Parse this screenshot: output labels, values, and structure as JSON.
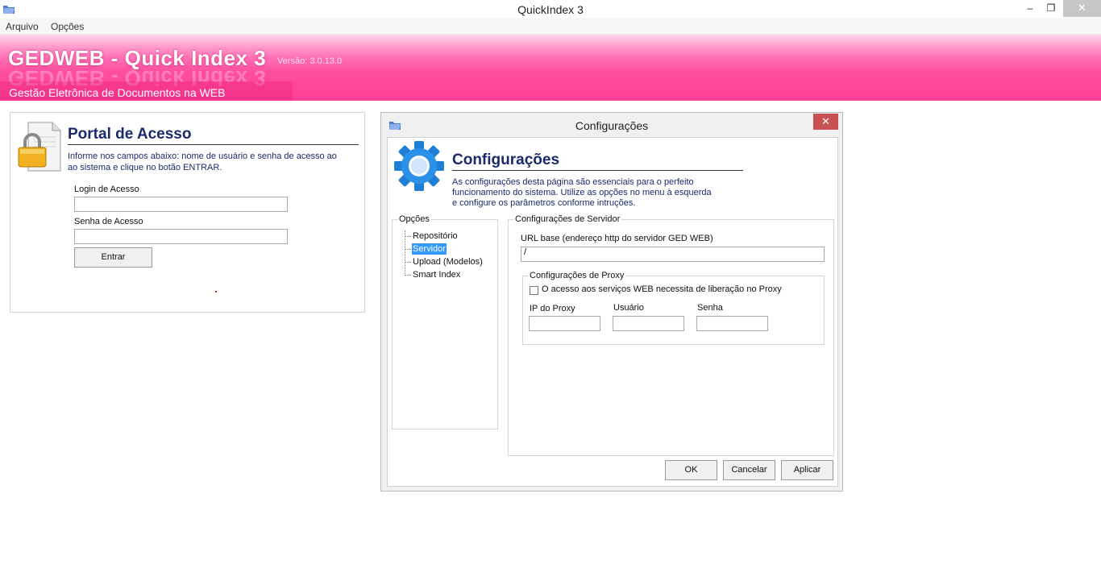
{
  "window": {
    "title": "QuickIndex 3",
    "minimize": "–",
    "maximize": "❐",
    "close": "✕"
  },
  "menu": {
    "items": [
      "Arquivo",
      "Opções"
    ]
  },
  "banner": {
    "brand": "GEDWEB - Quick Index 3",
    "version": "Versão:  3.0.13.0",
    "subtitle": "Gestão Eletrônica de Documentos na WEB"
  },
  "login": {
    "title": "Portal de Acesso",
    "description": "Informe nos campos abaixo: nome de usuário e senha de acesso ao ao sistema e clique no botão ENTRAR.",
    "login_label": "Login de Acesso",
    "login_value": "",
    "password_label": "Senha de Acesso",
    "password_value": "",
    "enter_button": "Entrar"
  },
  "dialog": {
    "title": "Configurações",
    "close": "✕",
    "heading": "Configurações",
    "description": "As configurações desta página são essenciais para o perfeito funcionamento do sistema. Utilize as opções no menu à esquerda e configure os parâmetros conforme intruções.",
    "options_group": "Opções",
    "tree": [
      "Repositório",
      "Servidor",
      "Upload (Modelos)",
      "Smart Index"
    ],
    "selected_tree_item": "Servidor",
    "server_group": "Configurações de Servidor",
    "url_label": "URL base (endereço http do servidor GED WEB)",
    "url_value": "/",
    "proxy_group": "Configurações de Proxy",
    "proxy_checkbox_label": "O acesso aos serviços WEB necessita de liberação no Proxy",
    "proxy_checked": false,
    "proxy_ip_label": "IP do Proxy",
    "proxy_user_label": "Usuário",
    "proxy_password_label": "Senha",
    "ok_button": "OK",
    "cancel_button": "Cancelar",
    "apply_button": "Aplicar"
  },
  "colors": {
    "banner_pink": "#ff3e94",
    "heading_navy": "#1a2a6c",
    "selection_blue": "#3399ff",
    "close_red": "#c75050"
  }
}
